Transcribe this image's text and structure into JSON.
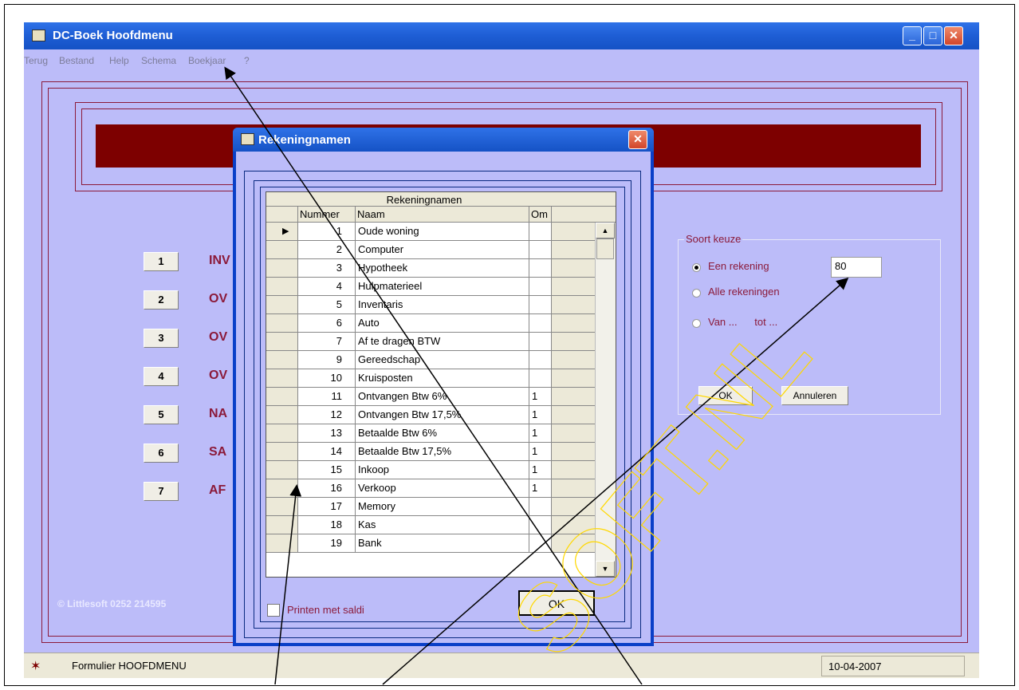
{
  "main_window": {
    "title": "DC-Boek Hoofdmenu",
    "menu": [
      "Terug",
      "Bestand",
      "Help",
      "Schema",
      "Boekjaar",
      "?"
    ],
    "menu_buttons": [
      {
        "number": "1",
        "label": "INV"
      },
      {
        "number": "2",
        "label": "OV"
      },
      {
        "number": "3",
        "label": "OV"
      },
      {
        "number": "4",
        "label": "OV"
      },
      {
        "number": "5",
        "label": "NA"
      },
      {
        "number": "6",
        "label": "SA"
      },
      {
        "number": "7",
        "label": "AF"
      }
    ],
    "copyright": "© Littlesoft 0252 214595",
    "status_text": "Formulier HOOFDMENU",
    "status_date": "10-04-2007"
  },
  "soort_keuze": {
    "legend": "Soort keuze",
    "options": [
      "Een rekening",
      "Alle rekeningen",
      "Van ...      tot ..."
    ],
    "selected_index": 0,
    "rekening_value": "80",
    "ok_label": "OK",
    "cancel_label": "Annuleren"
  },
  "dialog": {
    "title": "Rekeningnamen",
    "grid_title": "Rekeningnamen",
    "columns": [
      "Nummer",
      "Naam",
      "Om"
    ],
    "rows": [
      {
        "num": "1",
        "naam": "Oude woning",
        "om": ""
      },
      {
        "num": "2",
        "naam": "Computer",
        "om": ""
      },
      {
        "num": "3",
        "naam": "Hypotheek",
        "om": ""
      },
      {
        "num": "4",
        "naam": "Hulpmaterieel",
        "om": ""
      },
      {
        "num": "5",
        "naam": "Inventaris",
        "om": ""
      },
      {
        "num": "6",
        "naam": "Auto",
        "om": ""
      },
      {
        "num": "7",
        "naam": "Af te dragen BTW",
        "om": ""
      },
      {
        "num": "9",
        "naam": "Gereedschap",
        "om": ""
      },
      {
        "num": "10",
        "naam": "Kruisposten",
        "om": ""
      },
      {
        "num": "11",
        "naam": "Ontvangen Btw 6%",
        "om": "1"
      },
      {
        "num": "12",
        "naam": "Ontvangen Btw 17,5%",
        "om": "1"
      },
      {
        "num": "13",
        "naam": "Betaalde Btw 6%",
        "om": "1"
      },
      {
        "num": "14",
        "naam": "Betaalde Btw 17,5%",
        "om": "1"
      },
      {
        "num": "15",
        "naam": "Inkoop",
        "om": "1"
      },
      {
        "num": "16",
        "naam": "Verkoop",
        "om": "1"
      },
      {
        "num": "17",
        "naam": "Memory",
        "om": ""
      },
      {
        "num": "18",
        "naam": "Kas",
        "om": ""
      },
      {
        "num": "19",
        "naam": "Bank",
        "om": ""
      }
    ],
    "current_row": 0,
    "print_checkbox_label": "Printen met saldi",
    "ok_label": "OK"
  },
  "watermark": "SOFT.NL",
  "colors": {
    "window_bg": "#bcbcf9",
    "banner": "#7d0000",
    "label_red": "#8b1a3a",
    "titlebar_blue": "#1f5fd6"
  }
}
